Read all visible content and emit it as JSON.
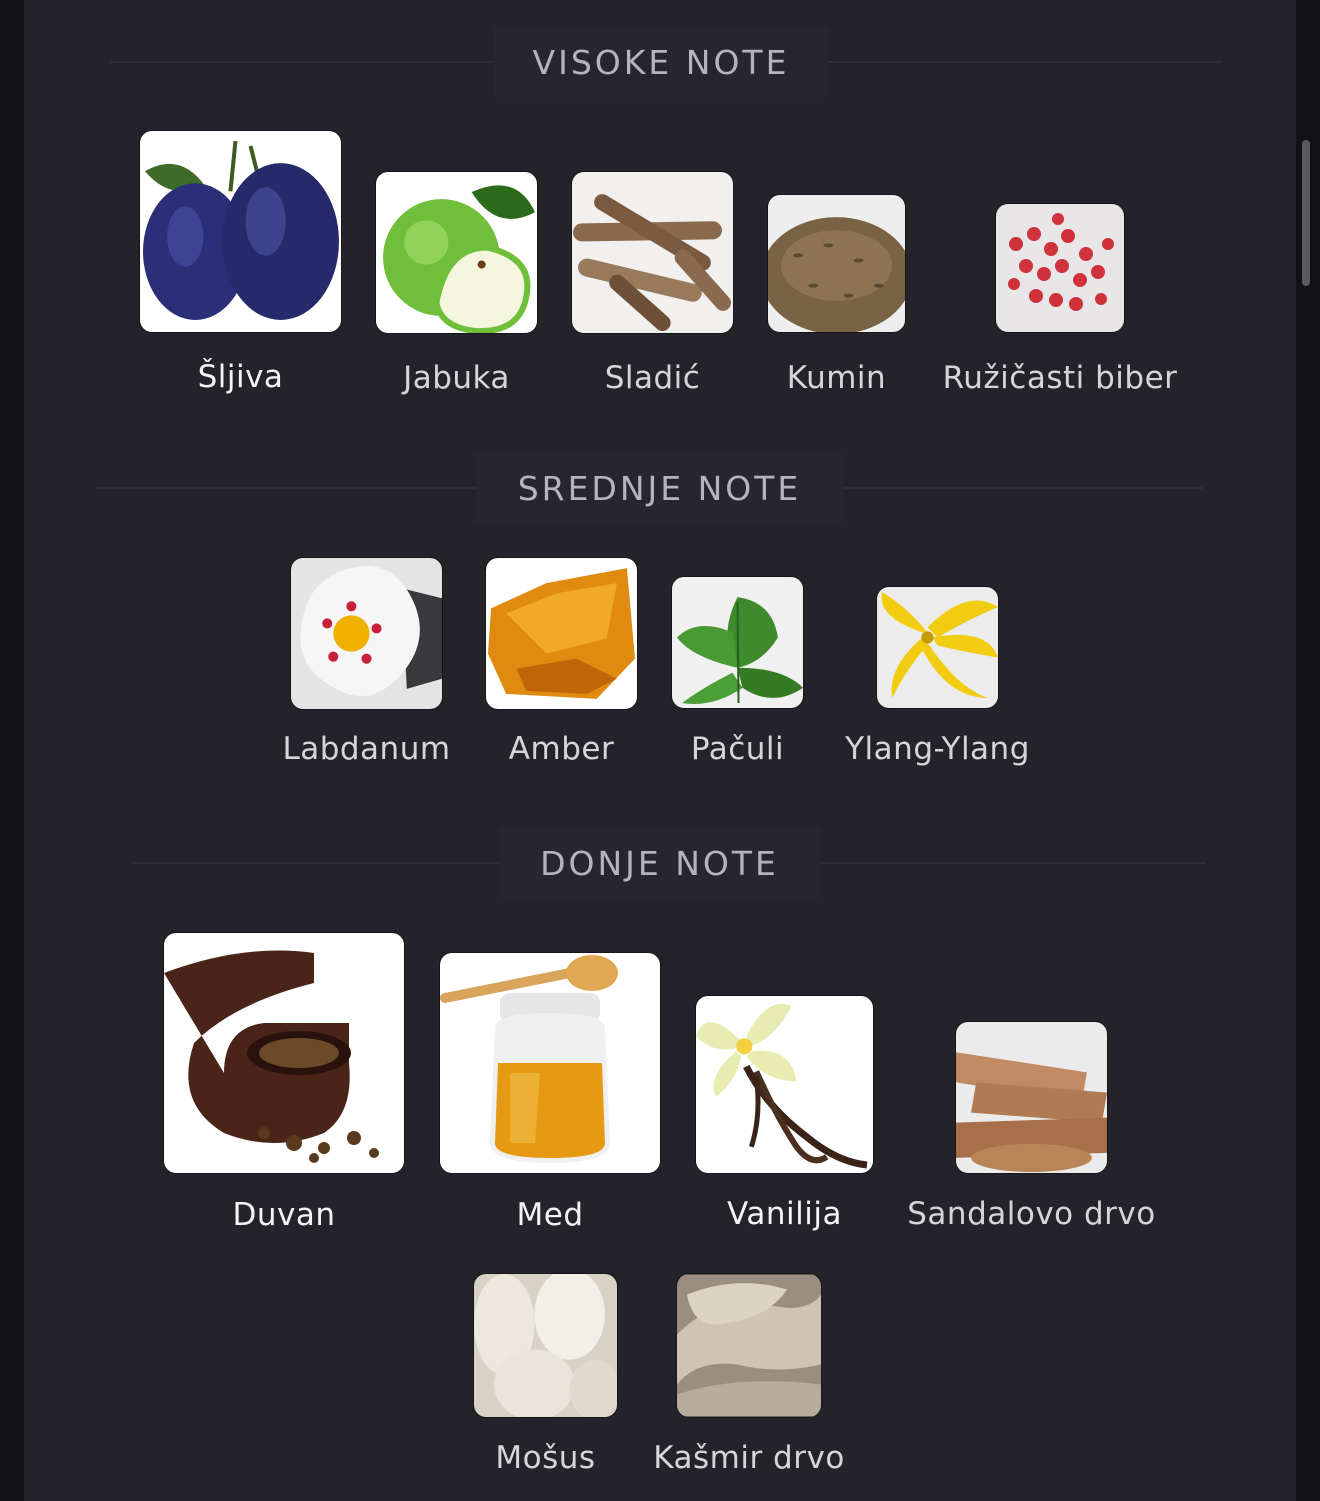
{
  "sections": {
    "top": {
      "title": "VISOKE NOTE",
      "notes": [
        {
          "label": "Šljiva",
          "icon": "plum-icon"
        },
        {
          "label": "Jabuka",
          "icon": "apple-icon"
        },
        {
          "label": "Sladić",
          "icon": "licorice-icon"
        },
        {
          "label": "Kumin",
          "icon": "cumin-icon"
        },
        {
          "label": "Ružičasti biber",
          "icon": "pink-pepper-icon"
        }
      ]
    },
    "middle": {
      "title": "SREDNJE NOTE",
      "notes": [
        {
          "label": "Labdanum",
          "icon": "labdanum-flower-icon"
        },
        {
          "label": "Amber",
          "icon": "amber-icon"
        },
        {
          "label": "Pačuli",
          "icon": "patchouli-leaf-icon"
        },
        {
          "label": "Ylang-Ylang",
          "icon": "ylang-ylang-flower-icon"
        }
      ]
    },
    "base": {
      "title": "DONJE NOTE",
      "notes": [
        {
          "label": "Duvan",
          "icon": "tobacco-pipe-icon"
        },
        {
          "label": "Med",
          "icon": "honey-jar-icon"
        },
        {
          "label": "Vanilija",
          "icon": "vanilla-icon"
        },
        {
          "label": "Sandalovo drvo",
          "icon": "sandalwood-icon"
        },
        {
          "label": "Mošus",
          "icon": "musk-icon"
        },
        {
          "label": "Kašmir drvo",
          "icon": "cashmere-wood-icon"
        }
      ]
    }
  }
}
